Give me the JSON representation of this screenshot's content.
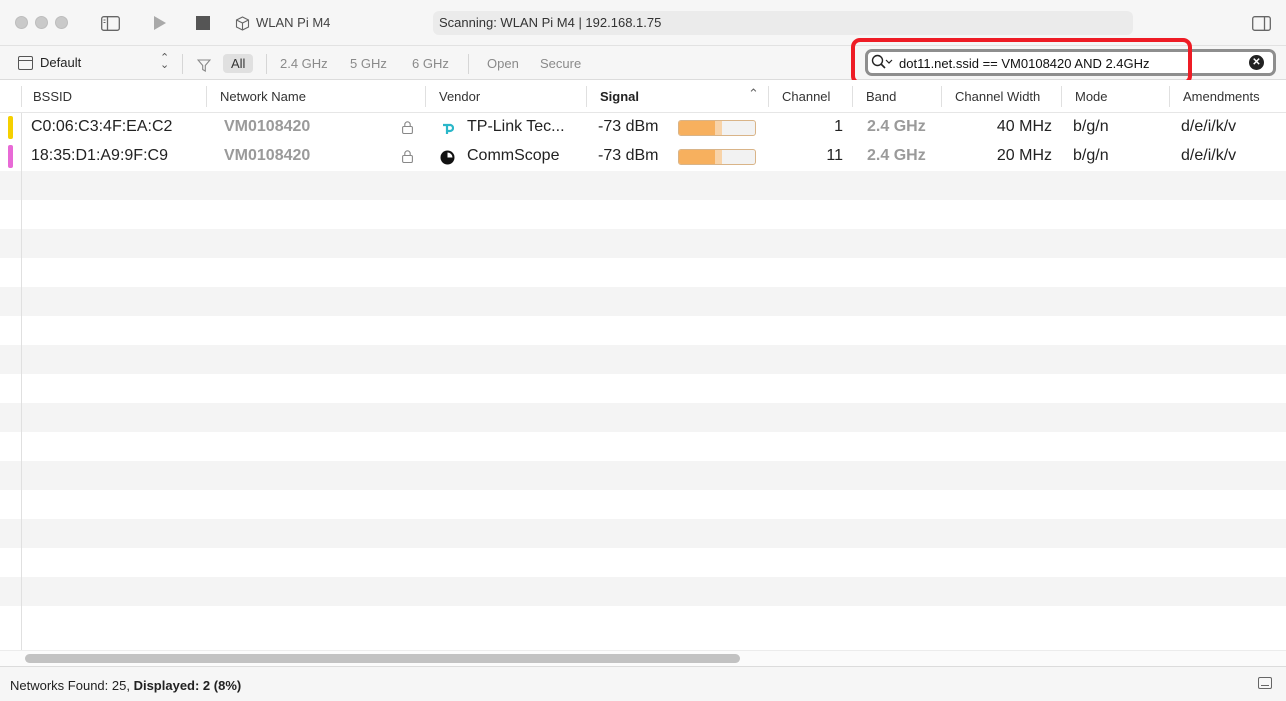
{
  "window": {
    "device_name": "WLAN Pi M4",
    "status": "Scanning: WLAN Pi M4 | 192.168.1.75"
  },
  "toolbar": {
    "profile": "Default",
    "band_filters": [
      "All",
      "2.4 GHz",
      "5 GHz",
      "6 GHz"
    ],
    "security_filters": [
      "Open",
      "Secure"
    ],
    "active_filter": "All",
    "search_query": "dot11.net.ssid == VM0108420 AND 2.4GHz",
    "highlight_color": "#ee1c25"
  },
  "columns": [
    "BSSID",
    "Network Name",
    "Vendor",
    "Signal",
    "Channel",
    "Band",
    "Channel Width",
    "Mode",
    "Amendments"
  ],
  "sorted_column": "Signal",
  "rows": [
    {
      "marker_color": "#f5d000",
      "bssid": "C0:06:C3:4F:EA:C2",
      "network_name": "VM0108420",
      "vendor": "TP-Link Tec...",
      "vendor_icon": "tp-link-icon",
      "signal": "-73 dBm",
      "signal_level": 0.47,
      "channel": "1",
      "band": "2.4 GHz",
      "channel_width": "40 MHz",
      "mode": "b/g/n",
      "amendments": "d/e/i/k/v"
    },
    {
      "marker_color": "#e86ad6",
      "bssid": "18:35:D1:A9:9F:C9",
      "network_name": "VM0108420",
      "vendor": "CommScope",
      "vendor_icon": "commscope-icon",
      "signal": "-73 dBm",
      "signal_level": 0.47,
      "channel": "11",
      "band": "2.4 GHz",
      "channel_width": "20 MHz",
      "mode": "b/g/n",
      "amendments": "d/e/i/k/v"
    }
  ],
  "status": {
    "found_label": "Networks Found: 25,",
    "displayed_label": "Displayed: 2 (8%)"
  }
}
